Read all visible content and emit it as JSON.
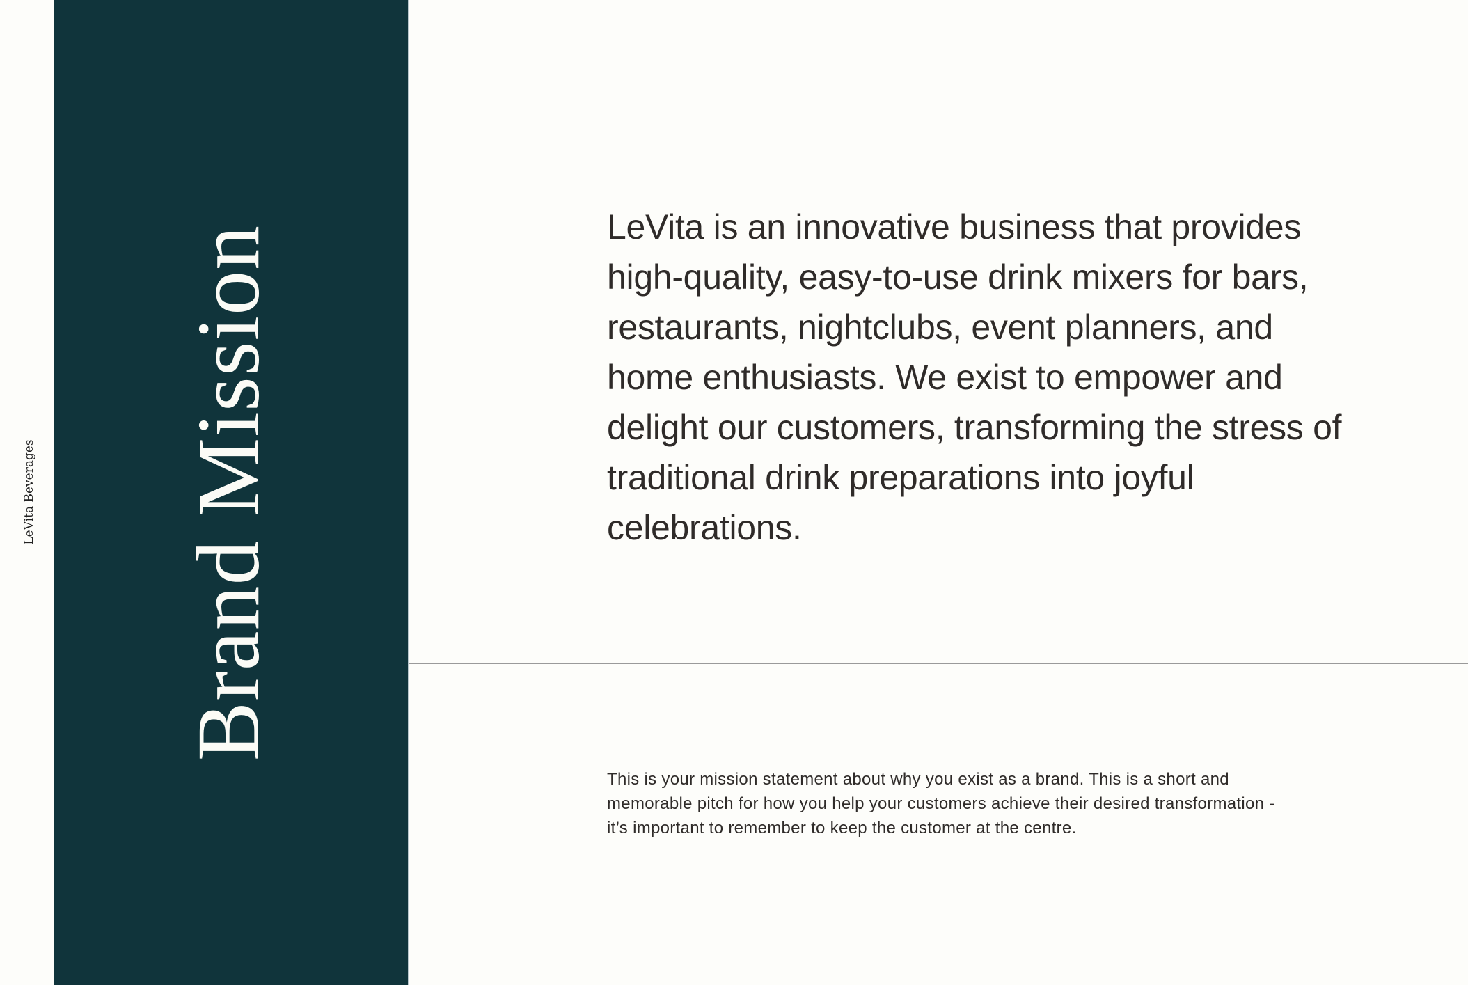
{
  "sidebar": {
    "brand_name": "LeVita Beverages"
  },
  "title_panel": {
    "title": "Brand Mission"
  },
  "main": {
    "mission_lead": "LeVita is an innovative business that provides high-quality, easy-to-use drink mixers for bars, restaurants, nightclubs, event planners, and home enthusiasts. We exist to empower and delight our customers, transforming the stress of traditional drink preparations into joyful celebrations.",
    "mission_note": "This is your mission statement about why you exist as a brand. This is a short and memorable pitch for how you help your customers achieve their desired transformation - it’s important to remember to keep the customer at the centre."
  },
  "colors": {
    "background": "#fdfdfa",
    "panel": "#10343b",
    "title_text": "#fbfbf6",
    "body_text": "#2f2b29",
    "divider": "#9a9a9a"
  }
}
